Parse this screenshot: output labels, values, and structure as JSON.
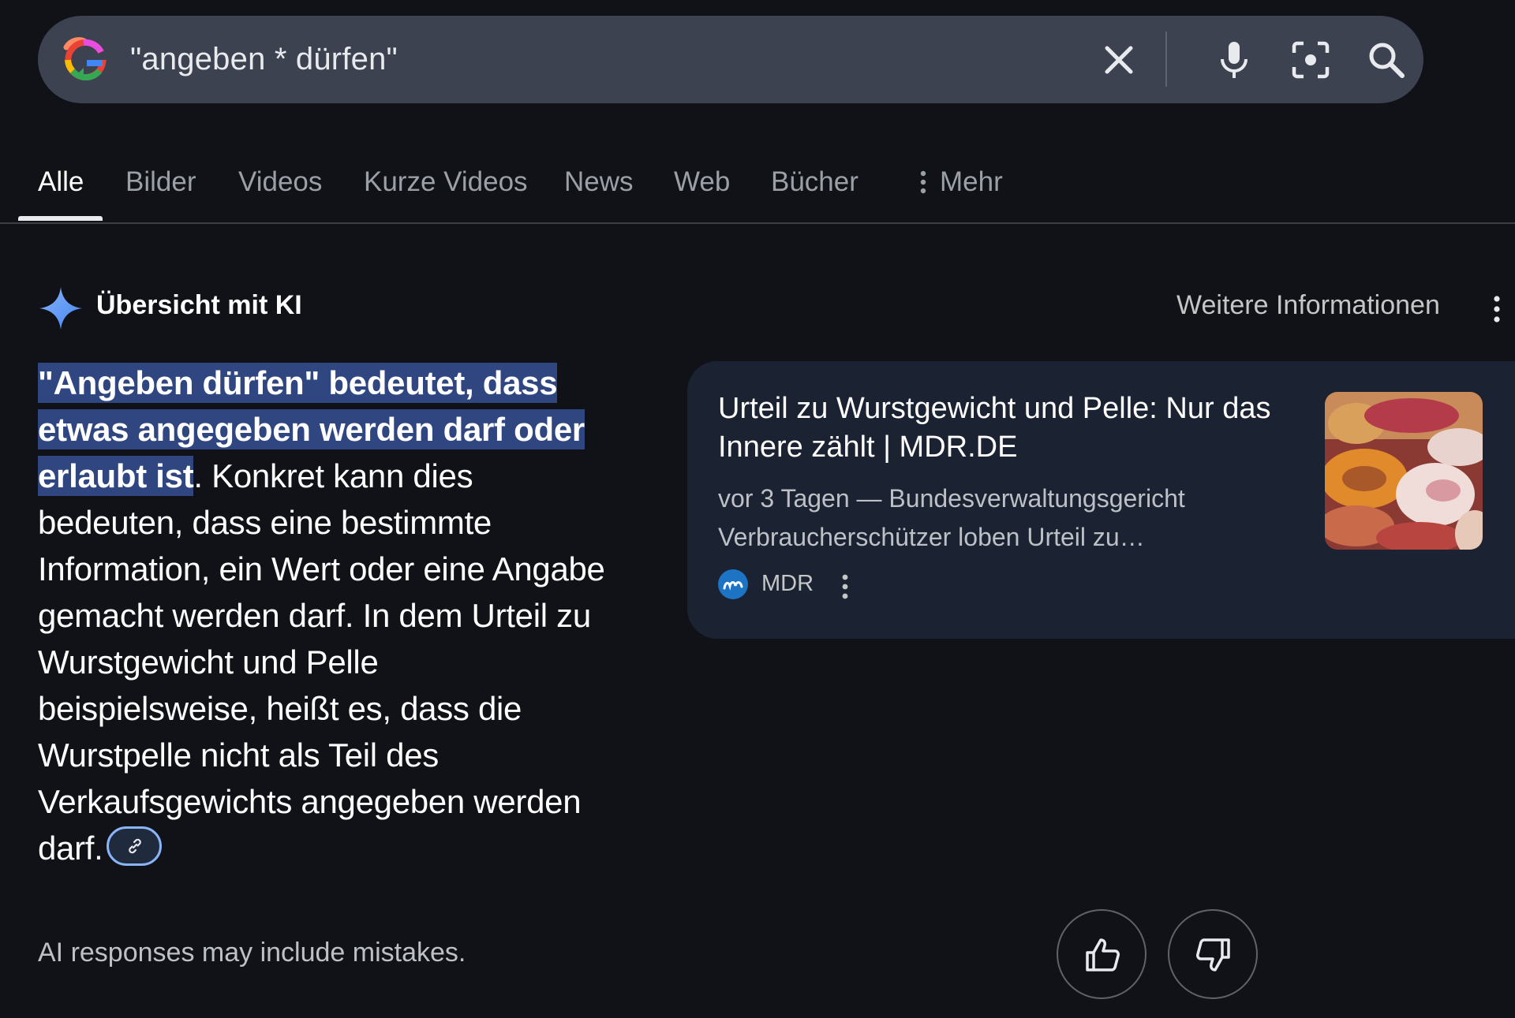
{
  "search": {
    "query": "\"angeben * dürfen\"",
    "icons": [
      "google-logo-icon",
      "clear-icon",
      "mic-icon",
      "lens-icon",
      "search-icon"
    ]
  },
  "tabs": [
    {
      "label": "Alle",
      "active": true
    },
    {
      "label": "Bilder"
    },
    {
      "label": "Videos"
    },
    {
      "label": "Kurze Videos"
    },
    {
      "label": "News"
    },
    {
      "label": "Web"
    },
    {
      "label": "Bücher"
    },
    {
      "label": "Mehr"
    }
  ],
  "ai_overview": {
    "title": "Übersicht mit KI",
    "more_info": "Weitere Informationen",
    "highlight": "\"Angeben dürfen\" bedeutet, dass etwas angegeben werden darf oder erlaubt ist",
    "body": ". Konkret kann dies bedeuten, dass eine bestimmte Information, ein Wert oder eine Angabe gemacht werden darf. In dem Urteil zu Wurstgewicht und Pelle beispielsweise, heißt es, dass die Wurstpelle nicht als Teil des Verkaufsgewichts angegeben werden darf."
  },
  "source_card": {
    "title": "Urteil zu Wurstgewicht und Pelle: Nur das Innere zählt | MDR.DE",
    "snippet": "vor 3 Tagen — Bundesverwaltungsgericht Verbraucherschützer loben Urteil zu…",
    "source": "MDR"
  },
  "footer": {
    "disclaimer": "AI responses may include mistakes."
  },
  "colors": {
    "background": "#101218",
    "search_bar": "#3c4250",
    "highlight": "#2f4680",
    "card": "#1b2232",
    "link_accent": "#8ab4f8"
  }
}
